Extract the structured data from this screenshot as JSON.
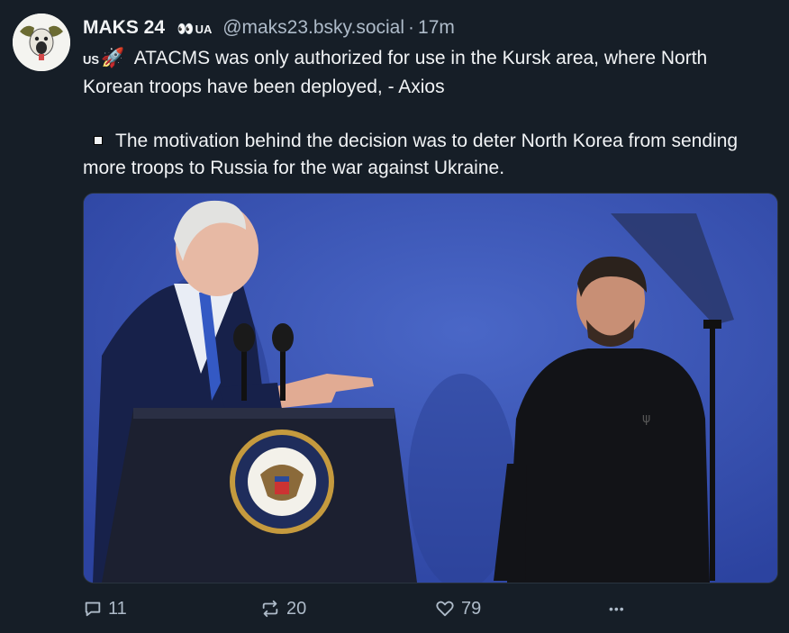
{
  "post": {
    "author_name": "MAKS 24",
    "badge_eyes": "👀",
    "badge_country": "UA",
    "handle": "@maks23.bsky.social",
    "separator": "·",
    "timestamp": "17m",
    "text_flag": "US",
    "text_emoji": "🚀",
    "line1": "ATACMS was only authorized for use in the Kursk area, where North Korean troops have been deployed, - Axios",
    "line2": "The motivation behind the decision was to deter North Korea from sending more troops to Russia for the war against Ukraine."
  },
  "actions": {
    "reply_count": "11",
    "repost_count": "20",
    "like_count": "79",
    "more_label": "•••"
  },
  "icons": {
    "reply": "speech-bubble-icon",
    "repost": "repost-arrows-icon",
    "like": "heart-icon",
    "more": "more-dots-icon"
  },
  "colors": {
    "background": "#161e27",
    "text": "#f1f3f5",
    "muted": "#aebbc9"
  }
}
